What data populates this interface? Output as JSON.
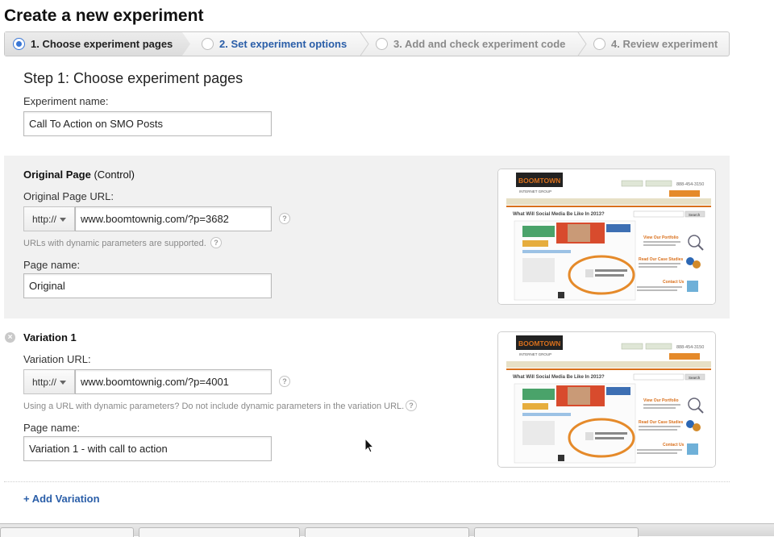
{
  "page_title": "Create a new experiment",
  "steps": [
    {
      "label": "1. Choose experiment pages",
      "state": "active"
    },
    {
      "label": "2. Set experiment options",
      "state": "link"
    },
    {
      "label": "3. Add and check experiment code",
      "state": "inactive"
    },
    {
      "label": "4. Review experiment",
      "state": "inactive"
    }
  ],
  "step_heading": "Step 1: Choose experiment pages",
  "experiment_name": {
    "label": "Experiment name:",
    "value": "Call To Action on SMO Posts"
  },
  "original": {
    "title": "Original Page",
    "title_suffix": "(Control)",
    "url_label": "Original Page URL:",
    "protocol": "http://",
    "url": "www.boomtownig.com/?p=3682",
    "hint": "URLs with dynamic parameters are supported.",
    "page_name_label": "Page name:",
    "page_name": "Original"
  },
  "variation": {
    "title": "Variation 1",
    "url_label": "Variation URL:",
    "protocol": "http://",
    "url": "www.boomtownig.com/?p=4001",
    "hint": "Using a URL with dynamic parameters? Do not include dynamic parameters in the variation URL.",
    "page_name_label": "Page name:",
    "page_name": "Variation 1 - with call to action"
  },
  "help_glyph": "?",
  "remove_glyph": "×",
  "add_variation": "+ Add Variation",
  "thumbnail": {
    "logo": "BOOMTOWN",
    "logo_sub": "INTERNET GROUP",
    "phone": "888-454-3150",
    "headline": "What Will Social Media Be Like In 2013?",
    "link1": "View Our Portfolio",
    "link2": "Read Our Case Studies",
    "link3": "Contact Us",
    "search_button": "Search",
    "brand_color": "#d9701c",
    "accent_color": "#e58a2a"
  },
  "colors": {
    "accent": "#3a77d5",
    "link": "#2a5ea8",
    "panel_bg": "#f1f1f1"
  }
}
